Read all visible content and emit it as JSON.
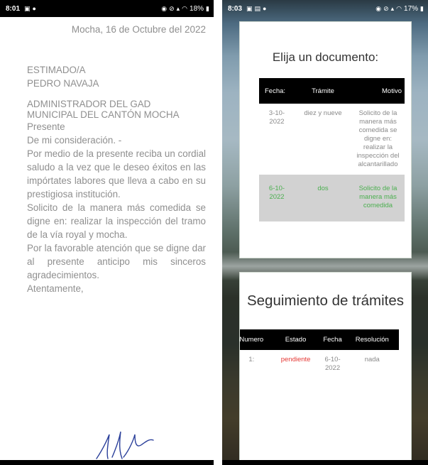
{
  "left_phone": {
    "status": {
      "time": "8:01",
      "battery": "18%"
    },
    "letter": {
      "date_line": "Mocha, 16 de Octubre del 2022",
      "salutation": "ESTIMADO/A",
      "recipient_name": "PEDRO NAVAJA",
      "recipient_title_1": "ADMINISTRADOR DEL GAD",
      "recipient_title_2": "MUNICIPAL DEL CANTÓN MOCHA",
      "presente": "Presente",
      "consideracion": "De mi consideración. -",
      "paragraph_1": "Por medio de la presente reciba un cordial saludo a la vez que le deseo éxitos en las impórtates labores que lleva a cabo en su prestigiosa institución.",
      "paragraph_2": "Solicito de la manera más comedida se digne en: realizar la inspección del tramo de la vía royal y mocha.",
      "paragraph_3": "Por la favorable atención que se digne dar al presente anticipo mis sinceros agradecimientos.",
      "closing": "Atentamente,"
    }
  },
  "right_phone": {
    "status": {
      "time": "8:03",
      "battery": "17%"
    },
    "documents_card": {
      "title": "Elija un documento:",
      "headers": [
        "Fecha:",
        "Trámite",
        "Motivo"
      ],
      "rows": [
        {
          "fecha": "3-10-2022",
          "tramite": "diez y nueve",
          "motivo": "Solicito de la manera más comedida se digne en: realizar la inspección del alcantarillado"
        },
        {
          "fecha": "6-10-2022",
          "tramite": "dos",
          "motivo": "Solicito de la manera más comedida"
        }
      ]
    },
    "tracking_card": {
      "title": "Seguimiento de trámites",
      "headers": [
        "Numero",
        "Estado",
        "Fecha",
        "Resolución"
      ],
      "rows": [
        {
          "numero": "1:",
          "estado": "pendiente",
          "fecha": "6-10-2022",
          "resolucion": "nada"
        }
      ]
    }
  },
  "colors": {
    "pending_status": "#e53935",
    "selected_row_text": "#4caf50",
    "selected_row_bg": "#d2d2d2"
  }
}
